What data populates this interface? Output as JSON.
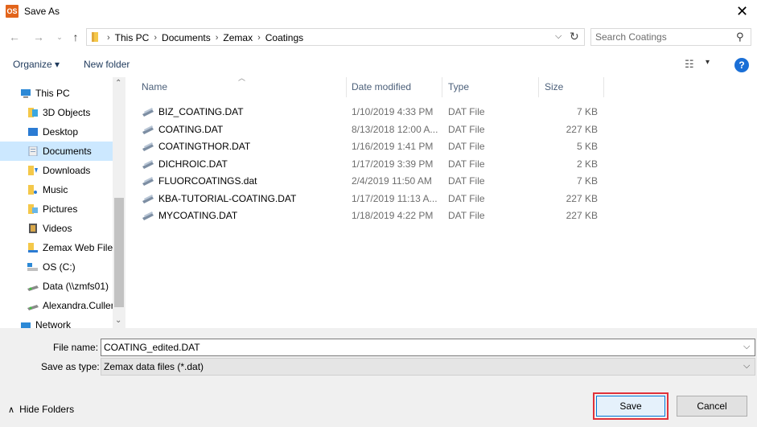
{
  "window": {
    "title": "Save As",
    "app_icon_text": "OS"
  },
  "nav": {
    "crumbs": [
      "This PC",
      "Documents",
      "Zemax",
      "Coatings"
    ],
    "search_placeholder": "Search Coatings"
  },
  "toolbar": {
    "organize": "Organize ▾",
    "new_folder": "New folder",
    "help": "?"
  },
  "sidebar": {
    "items": [
      {
        "label": "This PC",
        "icon": "computer-icon",
        "indent": 0,
        "selected": false
      },
      {
        "label": "3D Objects",
        "icon": "3d-objects-icon",
        "indent": 1,
        "selected": false
      },
      {
        "label": "Desktop",
        "icon": "desktop-icon",
        "indent": 1,
        "selected": false
      },
      {
        "label": "Documents",
        "icon": "documents-icon",
        "indent": 1,
        "selected": true
      },
      {
        "label": "Downloads",
        "icon": "downloads-icon",
        "indent": 1,
        "selected": false
      },
      {
        "label": "Music",
        "icon": "music-icon",
        "indent": 1,
        "selected": false
      },
      {
        "label": "Pictures",
        "icon": "pictures-icon",
        "indent": 1,
        "selected": false
      },
      {
        "label": "Videos",
        "icon": "videos-icon",
        "indent": 1,
        "selected": false
      },
      {
        "label": "Zemax Web Files",
        "icon": "web-files-icon",
        "indent": 1,
        "selected": false
      },
      {
        "label": "OS (C:)",
        "icon": "drive-icon",
        "indent": 1,
        "selected": false
      },
      {
        "label": "Data (\\\\zmfs01)",
        "icon": "network-drive-icon",
        "indent": 1,
        "selected": false
      },
      {
        "label": "Alexandra.Culler",
        "icon": "network-drive-icon",
        "indent": 1,
        "selected": false
      },
      {
        "label": "Network",
        "icon": "network-icon",
        "indent": 0,
        "selected": false
      }
    ]
  },
  "files": {
    "columns": {
      "name": "Name",
      "date": "Date modified",
      "type": "Type",
      "size": "Size"
    },
    "rows": [
      {
        "name": "BIZ_COATING.DAT",
        "date": "1/10/2019 4:33 PM",
        "type": "DAT File",
        "size": "7 KB"
      },
      {
        "name": "COATING.DAT",
        "date": "8/13/2018 12:00 A...",
        "type": "DAT File",
        "size": "227 KB"
      },
      {
        "name": "COATINGTHOR.DAT",
        "date": "1/16/2019 1:41 PM",
        "type": "DAT File",
        "size": "5 KB"
      },
      {
        "name": "DICHROIC.DAT",
        "date": "1/17/2019 3:39 PM",
        "type": "DAT File",
        "size": "2 KB"
      },
      {
        "name": "FLUORCOATINGS.dat",
        "date": "2/4/2019 11:50 AM",
        "type": "DAT File",
        "size": "7 KB"
      },
      {
        "name": "KBA-TUTORIAL-COATING.DAT",
        "date": "1/17/2019 11:13 A...",
        "type": "DAT File",
        "size": "227 KB"
      },
      {
        "name": "MYCOATING.DAT",
        "date": "1/18/2019 4:22 PM",
        "type": "DAT File",
        "size": "227 KB"
      }
    ]
  },
  "bottom": {
    "file_name_label": "File name:",
    "file_name_value": "COATING_edited.DAT",
    "save_type_label": "Save as type:",
    "save_type_value": "Zemax data files (*.dat)",
    "hide_folders": "Hide Folders",
    "save": "Save",
    "cancel": "Cancel"
  },
  "colors": {
    "accent": "#0078d7",
    "selection": "#cce8ff",
    "highlight_outline": "#e0323a"
  }
}
